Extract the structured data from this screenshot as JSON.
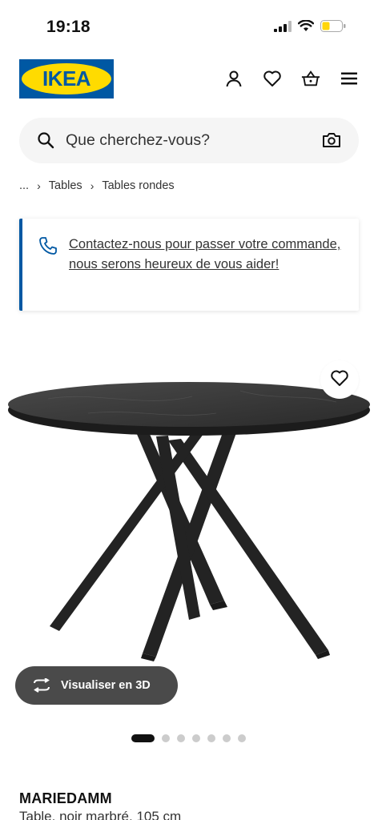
{
  "status_bar": {
    "time": "19:18",
    "icons": [
      "signal-icon",
      "wifi-icon",
      "battery-icon"
    ]
  },
  "header": {
    "logo_text": "IKEA",
    "brand_colors": {
      "blue": "#0058a3",
      "yellow": "#ffdb00"
    },
    "icons": [
      "account-icon",
      "heart-icon",
      "basket-icon",
      "menu-icon"
    ]
  },
  "search": {
    "placeholder": "Que cherchez-vous?"
  },
  "breadcrumb": {
    "items": [
      "...",
      "Tables",
      "Tables rondes"
    ]
  },
  "contact": {
    "text": "Contactez-nous pour passer votre commande, nous serons heureux de vous aider!"
  },
  "product": {
    "view_3d_label": "Visualiser en 3D",
    "carousel": {
      "total": 8,
      "active": 1
    },
    "name": "MARIEDAMM",
    "description": "Table, noir marbré, 105 cm"
  }
}
